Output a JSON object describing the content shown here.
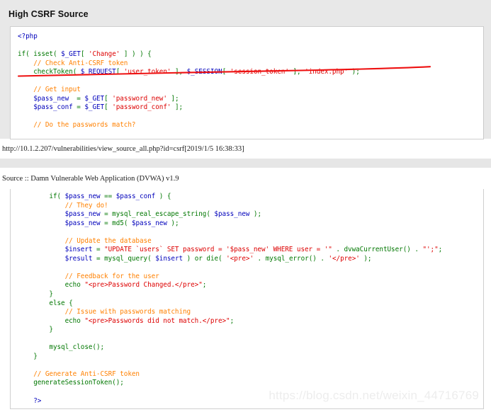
{
  "page_one": {
    "heading": "High CSRF Source",
    "code_lines": [
      [
        {
          "t": "<?php",
          "c": "v"
        }
      ],
      [
        {
          "t": "",
          "c": "d"
        }
      ],
      [
        {
          "t": "if",
          "c": "k"
        },
        {
          "t": "( ",
          "c": "p"
        },
        {
          "t": "isset",
          "c": "k"
        },
        {
          "t": "( ",
          "c": "p"
        },
        {
          "t": "$_GET",
          "c": "v"
        },
        {
          "t": "[ ",
          "c": "p"
        },
        {
          "t": "'Change'",
          "c": "s"
        },
        {
          "t": " ] ) ) {",
          "c": "p"
        }
      ],
      [
        {
          "t": "    ",
          "c": "d"
        },
        {
          "t": "// Check Anti-CSRF token",
          "c": "c"
        }
      ],
      [
        {
          "t": "    ",
          "c": "d"
        },
        {
          "t": "checkToken",
          "c": "k"
        },
        {
          "t": "( ",
          "c": "p"
        },
        {
          "t": "$_REQUEST",
          "c": "v"
        },
        {
          "t": "[ ",
          "c": "p"
        },
        {
          "t": "'user_token'",
          "c": "s"
        },
        {
          "t": " ], ",
          "c": "p"
        },
        {
          "t": "$_SESSION",
          "c": "v"
        },
        {
          "t": "[ ",
          "c": "p"
        },
        {
          "t": "'session_token'",
          "c": "s"
        },
        {
          "t": " ], ",
          "c": "p"
        },
        {
          "t": "'index.php'",
          "c": "s"
        },
        {
          "t": " );",
          "c": "p"
        }
      ],
      [
        {
          "t": "",
          "c": "d"
        }
      ],
      [
        {
          "t": "    ",
          "c": "d"
        },
        {
          "t": "// Get input",
          "c": "c"
        }
      ],
      [
        {
          "t": "    ",
          "c": "d"
        },
        {
          "t": "$pass_new",
          "c": "v"
        },
        {
          "t": "  = ",
          "c": "p"
        },
        {
          "t": "$_GET",
          "c": "v"
        },
        {
          "t": "[ ",
          "c": "p"
        },
        {
          "t": "'password_new'",
          "c": "s"
        },
        {
          "t": " ];",
          "c": "p"
        }
      ],
      [
        {
          "t": "    ",
          "c": "d"
        },
        {
          "t": "$pass_conf",
          "c": "v"
        },
        {
          "t": " = ",
          "c": "p"
        },
        {
          "t": "$_GET",
          "c": "v"
        },
        {
          "t": "[ ",
          "c": "p"
        },
        {
          "t": "'password_conf'",
          "c": "s"
        },
        {
          "t": " ];",
          "c": "p"
        }
      ],
      [
        {
          "t": "",
          "c": "d"
        }
      ],
      [
        {
          "t": "    ",
          "c": "d"
        },
        {
          "t": "// Do the passwords match?",
          "c": "c"
        }
      ]
    ],
    "annotation": {
      "type": "red-underline",
      "color": "#ee1111"
    }
  },
  "print_header": {
    "url": "http://10.1.2.207/vulnerabilities/view_source_all.php?id=csrf[2019/1/5 16:38:33]",
    "doc_title": "Source :: Damn Vulnerable Web Application (DVWA) v1.9"
  },
  "page_two": {
    "code_lines": [
      [
        {
          "t": "        ",
          "c": "d"
        },
        {
          "t": "if",
          "c": "k"
        },
        {
          "t": "( ",
          "c": "p"
        },
        {
          "t": "$pass_new",
          "c": "v"
        },
        {
          "t": " == ",
          "c": "p"
        },
        {
          "t": "$pass_conf",
          "c": "v"
        },
        {
          "t": " ) {",
          "c": "p"
        }
      ],
      [
        {
          "t": "            ",
          "c": "d"
        },
        {
          "t": "// They do!",
          "c": "c"
        }
      ],
      [
        {
          "t": "            ",
          "c": "d"
        },
        {
          "t": "$pass_new",
          "c": "v"
        },
        {
          "t": " = ",
          "c": "p"
        },
        {
          "t": "mysql_real_escape_string",
          "c": "k"
        },
        {
          "t": "( ",
          "c": "p"
        },
        {
          "t": "$pass_new",
          "c": "v"
        },
        {
          "t": " );",
          "c": "p"
        }
      ],
      [
        {
          "t": "            ",
          "c": "d"
        },
        {
          "t": "$pass_new",
          "c": "v"
        },
        {
          "t": " = ",
          "c": "p"
        },
        {
          "t": "md5",
          "c": "k"
        },
        {
          "t": "( ",
          "c": "p"
        },
        {
          "t": "$pass_new",
          "c": "v"
        },
        {
          "t": " );",
          "c": "p"
        }
      ],
      [
        {
          "t": "",
          "c": "d"
        }
      ],
      [
        {
          "t": "            ",
          "c": "d"
        },
        {
          "t": "// Update the database",
          "c": "c"
        }
      ],
      [
        {
          "t": "            ",
          "c": "d"
        },
        {
          "t": "$insert",
          "c": "v"
        },
        {
          "t": " = ",
          "c": "p"
        },
        {
          "t": "\"UPDATE `users` SET password = '$pass_new' WHERE user = '\"",
          "c": "s"
        },
        {
          "t": " . ",
          "c": "p"
        },
        {
          "t": "dvwaCurrentUser",
          "c": "k"
        },
        {
          "t": "() . ",
          "c": "p"
        },
        {
          "t": "\"';\"",
          "c": "s"
        },
        {
          "t": ";",
          "c": "p"
        }
      ],
      [
        {
          "t": "            ",
          "c": "d"
        },
        {
          "t": "$result",
          "c": "v"
        },
        {
          "t": " = ",
          "c": "p"
        },
        {
          "t": "mysql_query",
          "c": "k"
        },
        {
          "t": "( ",
          "c": "p"
        },
        {
          "t": "$insert",
          "c": "v"
        },
        {
          "t": " ) ",
          "c": "p"
        },
        {
          "t": "or",
          "c": "k"
        },
        {
          "t": " ",
          "c": "p"
        },
        {
          "t": "die",
          "c": "k"
        },
        {
          "t": "( ",
          "c": "p"
        },
        {
          "t": "'<pre>'",
          "c": "s"
        },
        {
          "t": " . ",
          "c": "p"
        },
        {
          "t": "mysql_error",
          "c": "k"
        },
        {
          "t": "() . ",
          "c": "p"
        },
        {
          "t": "'</pre>'",
          "c": "s"
        },
        {
          "t": " );",
          "c": "p"
        }
      ],
      [
        {
          "t": "",
          "c": "d"
        }
      ],
      [
        {
          "t": "            ",
          "c": "d"
        },
        {
          "t": "// Feedback for the user",
          "c": "c"
        }
      ],
      [
        {
          "t": "            ",
          "c": "d"
        },
        {
          "t": "echo",
          "c": "k"
        },
        {
          "t": " ",
          "c": "p"
        },
        {
          "t": "\"<pre>Password Changed.</pre>\"",
          "c": "s"
        },
        {
          "t": ";",
          "c": "p"
        }
      ],
      [
        {
          "t": "        ",
          "c": "d"
        },
        {
          "t": "}",
          "c": "p"
        }
      ],
      [
        {
          "t": "        ",
          "c": "d"
        },
        {
          "t": "else",
          "c": "k"
        },
        {
          "t": " {",
          "c": "p"
        }
      ],
      [
        {
          "t": "            ",
          "c": "d"
        },
        {
          "t": "// Issue with passwords matching",
          "c": "c"
        }
      ],
      [
        {
          "t": "            ",
          "c": "d"
        },
        {
          "t": "echo",
          "c": "k"
        },
        {
          "t": " ",
          "c": "p"
        },
        {
          "t": "\"<pre>Passwords did not match.</pre>\"",
          "c": "s"
        },
        {
          "t": ";",
          "c": "p"
        }
      ],
      [
        {
          "t": "        ",
          "c": "d"
        },
        {
          "t": "}",
          "c": "p"
        }
      ],
      [
        {
          "t": "",
          "c": "d"
        }
      ],
      [
        {
          "t": "        ",
          "c": "d"
        },
        {
          "t": "mysql_close",
          "c": "k"
        },
        {
          "t": "();",
          "c": "p"
        }
      ],
      [
        {
          "t": "    ",
          "c": "d"
        },
        {
          "t": "}",
          "c": "p"
        }
      ],
      [
        {
          "t": "",
          "c": "d"
        }
      ],
      [
        {
          "t": "    ",
          "c": "d"
        },
        {
          "t": "// Generate Anti-CSRF token",
          "c": "c"
        }
      ],
      [
        {
          "t": "    ",
          "c": "d"
        },
        {
          "t": "generateSessionToken",
          "c": "k"
        },
        {
          "t": "();",
          "c": "p"
        }
      ],
      [
        {
          "t": "",
          "c": "d"
        }
      ],
      [
        {
          "t": "    ",
          "c": "d"
        },
        {
          "t": "?>",
          "c": "v"
        }
      ]
    ],
    "watermark": "https://blog.csdn.net/weixin_44716769"
  },
  "colors": {
    "keyword_green": "#007700",
    "variable_blue": "#0000bb",
    "string_red": "#dd0000",
    "comment_orange": "#ff8000",
    "page_bg_gray": "#e8e8e8",
    "annotation_red": "#ee1111"
  }
}
